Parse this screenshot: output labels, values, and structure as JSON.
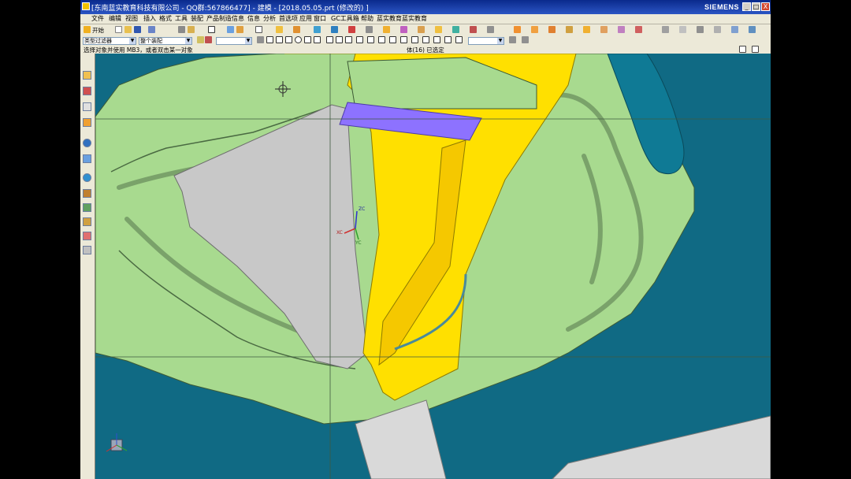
{
  "window": {
    "title": "[东南蓝实教育科技有限公司 - QQ群:567866477] - 建模 - [2018.05.05.prt  (修改的) ]",
    "brand": "SIEMENS",
    "controls": [
      "_",
      "□",
      "X"
    ]
  },
  "menu": [
    "文件",
    "编辑",
    "视图",
    "插入",
    "格式",
    "工具",
    "装配",
    "产品制造信息",
    "信息",
    "分析",
    "首选项",
    "应用",
    "窗口",
    "GC工具箱",
    "帮助",
    "蓝实教育",
    "蓝实教育"
  ],
  "toolbar": {
    "start_label": "开始",
    "selection_filter": "类型过滤器",
    "selection_scope": "整个装配"
  },
  "status": {
    "prompt": "选择对象并使用 MB3，或者双击某一对象",
    "selection": "体(16) 已选定"
  },
  "viewport": {
    "triad_labels": [
      "XC",
      "YC",
      "ZC"
    ]
  },
  "colors": {
    "titlebar": "#0a2a8c",
    "background": "#106a84",
    "mold_surface": "#a8da8f",
    "selected_body": "#ffe000",
    "highlight_face": "#8d72ff",
    "gray_face": "#c8c8c8"
  }
}
